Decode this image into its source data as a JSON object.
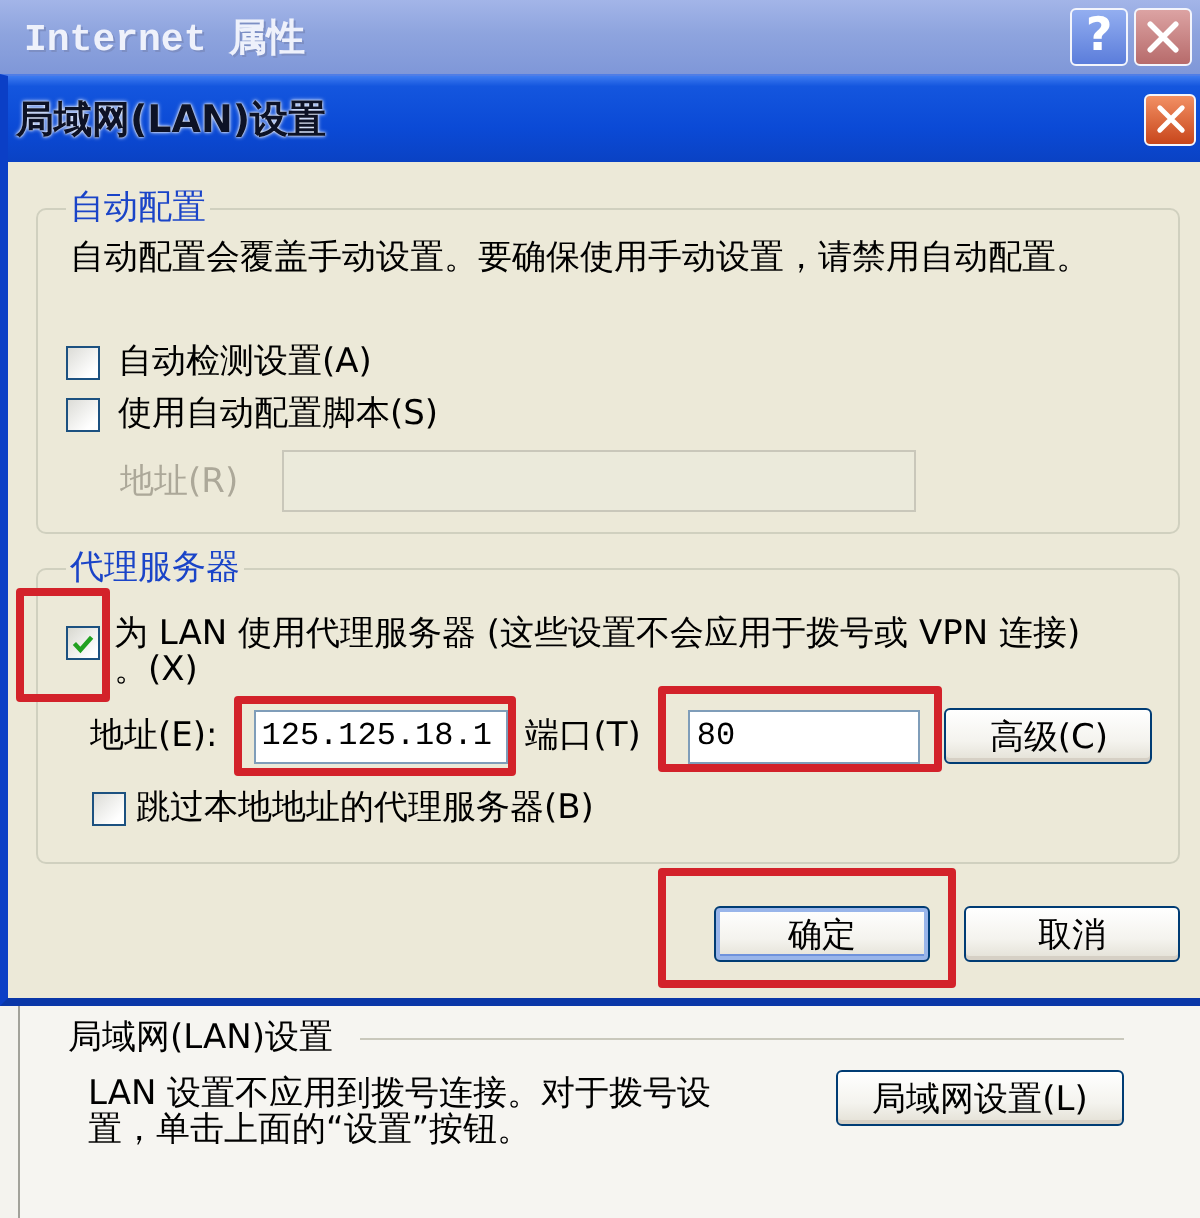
{
  "window": {
    "title": "Internet 属性",
    "help_glyph": "?"
  },
  "dialog": {
    "title": "局域网(LAN)设置",
    "auto_config": {
      "title": "自动配置",
      "description": "自动配置会覆盖手动设置。要确保使用手动设置，请禁用自动配置。",
      "options": [
        {
          "label": "自动检测设置(A)",
          "checked": false
        },
        {
          "label": "使用自动配置脚本(S)",
          "checked": false
        }
      ],
      "script_address": {
        "label": "地址(R)",
        "disabled": true
      }
    },
    "proxy_server": {
      "title": "代理服务器",
      "use_proxy": {
        "label_lines": [
          "为 LAN 使用代理服务器 (这些设置不会应用于拨号或 VPN 连接)",
          "。(X)"
        ],
        "checked": true,
        "highlighted": true
      },
      "address": {
        "label": "地址(E):",
        "value": "125.125.18.1",
        "highlighted": true
      },
      "port": {
        "label": "端口(T)",
        "value": "80",
        "highlighted": true
      },
      "advanced_button": "高级(C)",
      "bypass_local": {
        "label": "跳过本地地址的代理服务器(B)",
        "checked": false
      }
    },
    "buttons": [
      {
        "label": "确定",
        "default": true,
        "highlighted": true
      },
      {
        "label": "取消",
        "default": false,
        "highlighted": false
      }
    ]
  },
  "lan_group": {
    "title": "局域网(LAN)设置",
    "description_lines": [
      "LAN 设置不应用到拨号连接。对于拨号设",
      "置，单击上面的“设置”按钮。"
    ],
    "button": "局域网设置(L)"
  }
}
